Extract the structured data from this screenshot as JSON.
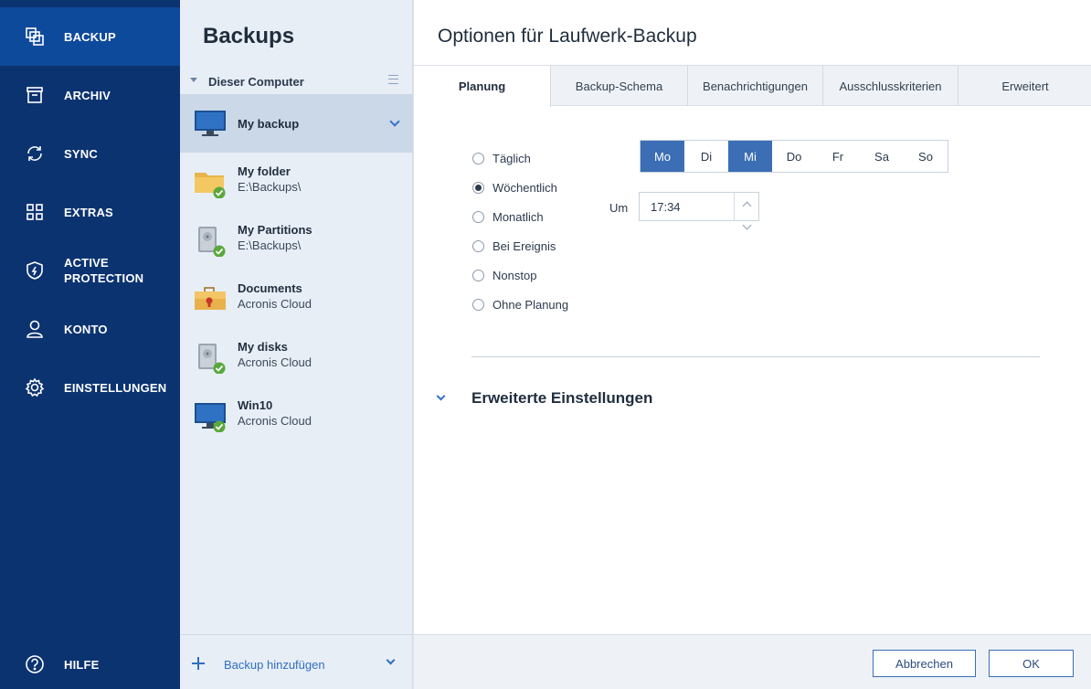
{
  "nav": {
    "items": [
      {
        "label": "BACKUP",
        "icon": "backup-copy-icon"
      },
      {
        "label": "ARCHIV",
        "icon": "archive-box-icon"
      },
      {
        "label": "SYNC",
        "icon": "sync-arrows-icon"
      },
      {
        "label": "EXTRAS",
        "icon": "grid-tools-icon"
      },
      {
        "label": "ACTIVE\nPROTECTION",
        "icon": "shield-icon"
      },
      {
        "label": "KONTO",
        "icon": "user-icon"
      },
      {
        "label": "EINSTELLUNGEN",
        "icon": "gear-icon"
      }
    ],
    "help_label": "HILFE",
    "active_color": "#0e4a9c",
    "bg_color": "#0b3370"
  },
  "list": {
    "title": "Backups",
    "group_label": "Dieser Computer",
    "items": [
      {
        "name": "My backup",
        "sub": "",
        "icon": "monitor-icon"
      },
      {
        "name": "My folder",
        "sub": "E:\\Backups\\",
        "icon": "folder-icon"
      },
      {
        "name": "My Partitions",
        "sub": "E:\\Backups\\",
        "icon": "disk-icon"
      },
      {
        "name": "Documents",
        "sub": "Acronis Cloud",
        "icon": "briefcase-icon"
      },
      {
        "name": "My disks",
        "sub": "Acronis Cloud",
        "icon": "disk-icon"
      },
      {
        "name": "Win10",
        "sub": "Acronis Cloud",
        "icon": "monitor-icon"
      }
    ],
    "add_label": "Backup hinzufügen"
  },
  "main": {
    "title": "Optionen für Laufwerk-Backup",
    "tabs": [
      "Planung",
      "Backup-Schema",
      "Benachrichtigungen",
      "Ausschlusskriterien",
      "Erweitert"
    ],
    "schedule_options": [
      "Täglich",
      "Wöchentlich",
      "Monatlich",
      "Bei Ereignis",
      "Nonstop",
      "Ohne Planung"
    ],
    "selected_option": "Wöchentlich",
    "days": [
      "Mo",
      "Di",
      "Mi",
      "Do",
      "Fr",
      "Sa",
      "So"
    ],
    "active_days": [
      "Mo",
      "Mi"
    ],
    "time_label": "Um",
    "time_value": "17:34",
    "advanced_label": "Erweiterte Einstellungen",
    "cancel_label": "Abbrechen",
    "ok_label": "OK",
    "accent_color": "#3b6eb5"
  }
}
